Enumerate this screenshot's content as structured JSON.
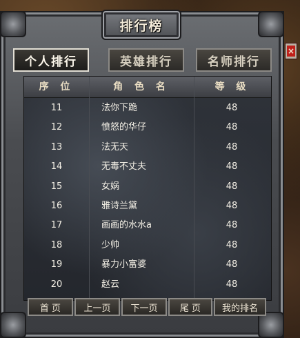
{
  "window": {
    "title": "排行榜",
    "close_label": "×"
  },
  "tabs": [
    {
      "label": "个人排行",
      "active": true
    },
    {
      "label": "英雄排行",
      "active": false
    },
    {
      "label": "名师排行",
      "active": false
    }
  ],
  "table": {
    "headers": {
      "rank": "序 位",
      "name": "角 色 名",
      "level": "等 级"
    },
    "rows": [
      {
        "rank": "11",
        "name": "法你下跪",
        "level": "48"
      },
      {
        "rank": "12",
        "name": "愤怒的华仔",
        "level": "48"
      },
      {
        "rank": "13",
        "name": "法无天",
        "level": "48"
      },
      {
        "rank": "14",
        "name": "无毒不丈夫",
        "level": "48"
      },
      {
        "rank": "15",
        "name": "女娲",
        "level": "48"
      },
      {
        "rank": "16",
        "name": "雅诗兰黛",
        "level": "48"
      },
      {
        "rank": "17",
        "name": "画画的水水a",
        "level": "48"
      },
      {
        "rank": "18",
        "name": "少帅",
        "level": "48"
      },
      {
        "rank": "19",
        "name": "暴力小富婆",
        "level": "48"
      },
      {
        "rank": "20",
        "name": "赵云",
        "level": "48"
      }
    ]
  },
  "pagination": {
    "first": "首 页",
    "prev": "上一页",
    "next": "下一页",
    "last": "尾 页",
    "my_rank": "我的排名"
  },
  "colors": {
    "close_button": "#c0201a",
    "text": "#f4f0e6",
    "header_text": "#e8dcc2"
  }
}
